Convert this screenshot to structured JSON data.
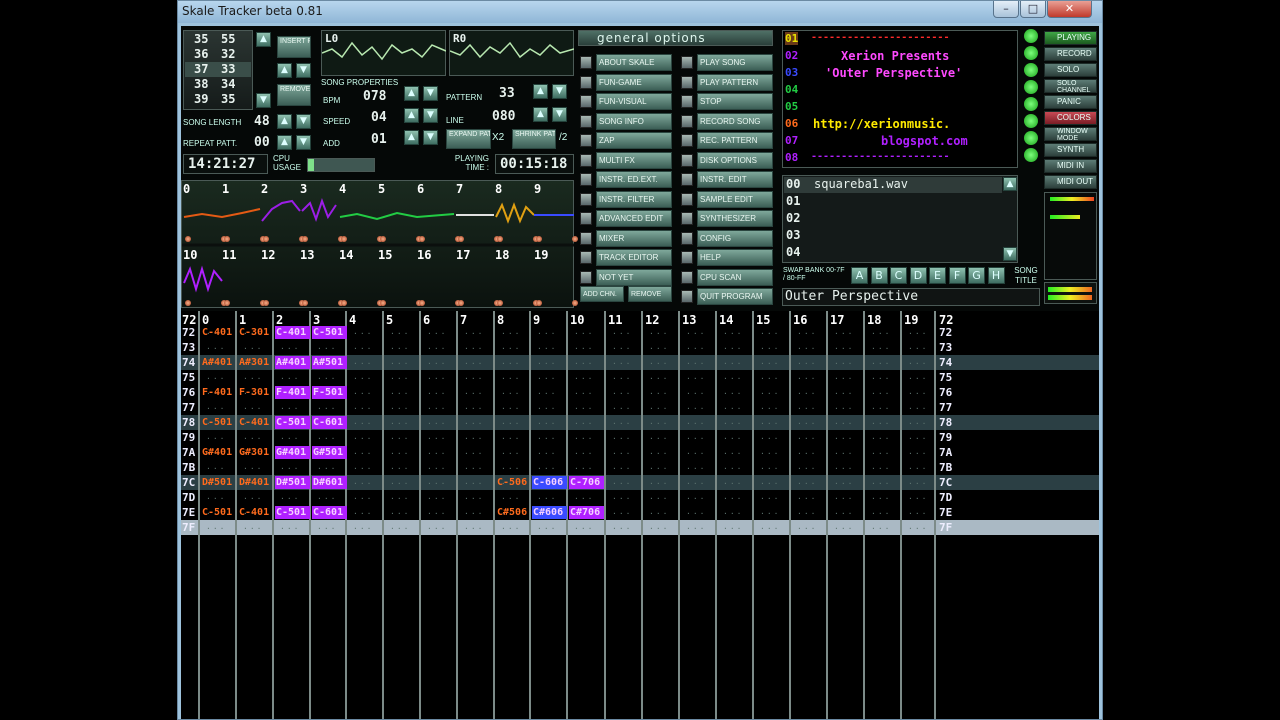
{
  "window": {
    "title": "Skale Tracker beta 0.81",
    "minimize": "–",
    "maximize": "□",
    "close": "✕"
  },
  "song_pos": {
    "rows": [
      {
        "a": "35",
        "b": "55"
      },
      {
        "a": "36",
        "b": "32"
      },
      {
        "a": "37",
        "b": "33"
      },
      {
        "a": "38",
        "b": "34"
      },
      {
        "a": "39",
        "b": "35"
      }
    ]
  },
  "insert_pattern": "INSERT PATTERN",
  "remove_pattern": "REMOVE PATTERN",
  "song_length": {
    "label": "SONG LENGTH",
    "value": "48"
  },
  "repeat_patt": {
    "label": "REPEAT PATT.",
    "value": "00"
  },
  "scopes": {
    "left": "L0",
    "right": "R0"
  },
  "song_properties": {
    "label": "SONG PROPERTIES",
    "bpm_label": "BPM",
    "bpm": "078",
    "speed_label": "SPEED",
    "speed": "04",
    "add_label": "ADD",
    "add": "01",
    "pattern_label": "PATTERN",
    "pattern": "33",
    "line_label": "LINE",
    "line": "080",
    "expand": "EXPAND PATTERN",
    "x2": "X2",
    "shrink": "SHRINK PATTERN",
    "div2": "/2"
  },
  "clock": "14:21:27",
  "cpu_label": "CPU USAGE",
  "playing_label": "PLAYING TIME :",
  "playing_time": "00:15:18",
  "tracks_top": [
    "0",
    "1",
    "2",
    "3",
    "4",
    "5",
    "6",
    "7",
    "8",
    "9"
  ],
  "tracks_bottom": [
    "10",
    "11",
    "12",
    "13",
    "14",
    "15",
    "16",
    "17",
    "18",
    "19"
  ],
  "general_options": "general options",
  "menu_left": [
    "ABOUT SKALE",
    "FUN-GAME",
    "FUN-VISUAL",
    "SONG INFO",
    "ZAP",
    "MULTI FX",
    "INSTR. ED.EXT.",
    "INSTR. FILTER",
    "ADVANCED EDIT",
    "MIXER",
    "TRACK EDITOR",
    "NOT YET"
  ],
  "menu_right": [
    "PLAY SONG",
    "PLAY PATTERN",
    "STOP",
    "RECORD SONG",
    "REC. PATTERN",
    "DISK OPTIONS",
    "INSTR. EDIT",
    "SAMPLE EDIT",
    "SYNTHESIZER",
    "CONFIG",
    "HELP",
    "CPU SCAN",
    "QUIT PROGRAM"
  ],
  "add_chn": "ADD CHN.",
  "remove": "REMOVE",
  "instruments": [
    {
      "num": "01",
      "text": "-----------------------"
    },
    {
      "num": "02",
      "text": "Xerion Presents"
    },
    {
      "num": "03",
      "text": "'Outer Perspective'"
    },
    {
      "num": "04",
      "text": ""
    },
    {
      "num": "05",
      "text": ""
    },
    {
      "num": "06",
      "text": "http://xerionmusic."
    },
    {
      "num": "07",
      "text": "blogspot.com"
    },
    {
      "num": "08",
      "text": "-----------------------"
    }
  ],
  "samples": [
    {
      "num": "00",
      "name": "squareba1.wav"
    },
    {
      "num": "01",
      "name": ""
    },
    {
      "num": "02",
      "name": ""
    },
    {
      "num": "03",
      "name": ""
    },
    {
      "num": "04",
      "name": ""
    }
  ],
  "swap_bank": "SWAP BANK 00-7F / 80-FF",
  "banks": [
    "A",
    "B",
    "C",
    "D",
    "E",
    "F",
    "G",
    "H"
  ],
  "song_title_label": "SONG TITLE",
  "song_title": "Outer Perspective",
  "right_buttons": [
    "PLAYING",
    "RECORD",
    "SOLO",
    "SOLO CHANNEL",
    "PANIC",
    "COLORS",
    "WINDOW MODE",
    "SYNTH",
    "MIDI IN",
    "MIDI OUT"
  ],
  "pattern": {
    "headers": [
      "0",
      "1",
      "2",
      "3",
      "4",
      "5",
      "6",
      "7",
      "8",
      "9",
      "10",
      "11",
      "12",
      "13",
      "14",
      "15",
      "16",
      "17",
      "18",
      "19"
    ],
    "rows": [
      "72",
      "73",
      "74",
      "75",
      "76",
      "77",
      "78",
      "79",
      "7A",
      "7B",
      "7C",
      "7D",
      "7E",
      "7F"
    ],
    "notes": [
      {
        "row": 0,
        "col": 0,
        "text": "C-401"
      },
      {
        "row": 0,
        "col": 1,
        "text": "C-301"
      },
      {
        "row": 0,
        "col": 2,
        "text": "C-401"
      },
      {
        "row": 0,
        "col": 3,
        "text": "C-501"
      },
      {
        "row": 2,
        "col": 0,
        "text": "A#401"
      },
      {
        "row": 2,
        "col": 1,
        "text": "A#301"
      },
      {
        "row": 2,
        "col": 2,
        "text": "A#401"
      },
      {
        "row": 2,
        "col": 3,
        "text": "A#501"
      },
      {
        "row": 4,
        "col": 0,
        "text": "F-401"
      },
      {
        "row": 4,
        "col": 1,
        "text": "F-301"
      },
      {
        "row": 4,
        "col": 2,
        "text": "F-401"
      },
      {
        "row": 4,
        "col": 3,
        "text": "F-501"
      },
      {
        "row": 6,
        "col": 0,
        "text": "C-501"
      },
      {
        "row": 6,
        "col": 1,
        "text": "C-401"
      },
      {
        "row": 6,
        "col": 2,
        "text": "C-501"
      },
      {
        "row": 6,
        "col": 3,
        "text": "C-601"
      },
      {
        "row": 8,
        "col": 0,
        "text": "G#401"
      },
      {
        "row": 8,
        "col": 1,
        "text": "G#301"
      },
      {
        "row": 8,
        "col": 2,
        "text": "G#401"
      },
      {
        "row": 8,
        "col": 3,
        "text": "G#501"
      },
      {
        "row": 10,
        "col": 0,
        "text": "D#501"
      },
      {
        "row": 10,
        "col": 1,
        "text": "D#401"
      },
      {
        "row": 10,
        "col": 2,
        "text": "D#501"
      },
      {
        "row": 10,
        "col": 3,
        "text": "D#601"
      },
      {
        "row": 10,
        "col": 8,
        "text": "C-506"
      },
      {
        "row": 10,
        "col": 9,
        "text": "C-606"
      },
      {
        "row": 10,
        "col": 10,
        "text": "C-706"
      },
      {
        "row": 12,
        "col": 0,
        "text": "C-501"
      },
      {
        "row": 12,
        "col": 1,
        "text": "C-401"
      },
      {
        "row": 12,
        "col": 2,
        "text": "C-501"
      },
      {
        "row": 12,
        "col": 3,
        "text": "C-601"
      },
      {
        "row": 12,
        "col": 8,
        "text": "C#506"
      },
      {
        "row": 12,
        "col": 9,
        "text": "C#606"
      },
      {
        "row": 12,
        "col": 10,
        "text": "C#706"
      }
    ]
  },
  "colors": {
    "orange": "#ff6a1c",
    "purple": "#b020ff",
    "blue": "#3a4bff",
    "green": "#2ee04a",
    "highlight": "#2b3f44",
    "cursor": "#aab9c4"
  }
}
